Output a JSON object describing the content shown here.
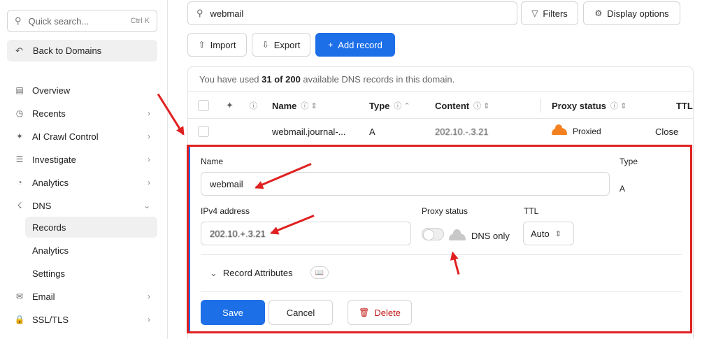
{
  "sidebar": {
    "search": {
      "placeholder": "Quick search...",
      "shortcut": "Ctrl K",
      "icon": "search-icon"
    },
    "back": "Back to Domains",
    "items": [
      {
        "label": "Overview",
        "icon": "overview-icon"
      },
      {
        "label": "Recents",
        "icon": "clock-icon"
      },
      {
        "label": "AI Crawl Control",
        "icon": "ai-icon"
      },
      {
        "label": "Investigate",
        "icon": "investigate-icon"
      },
      {
        "label": "Analytics",
        "icon": "analytics-icon"
      },
      {
        "label": "DNS",
        "icon": "dns-icon"
      },
      {
        "label": "Email",
        "icon": "email-icon"
      },
      {
        "label": "SSL/TLS",
        "icon": "lock-icon"
      }
    ],
    "dns_sub": [
      "Records",
      "Analytics",
      "Settings"
    ]
  },
  "toolbar": {
    "search_value": "webmail",
    "filters": "Filters",
    "display_options": "Display options",
    "import": "Import",
    "export": "Export",
    "add_record": "Add record"
  },
  "table": {
    "usage_prefix": "You have used ",
    "usage_count": "31 of 200",
    "usage_suffix": " available DNS records in this domain.",
    "headers": {
      "name": "Name",
      "type": "Type",
      "content": "Content",
      "proxy": "Proxy status",
      "ttl": "TTL"
    },
    "row": {
      "name": "webmail.journal-...",
      "type": "A",
      "content": "202.10.-.3.21",
      "proxy": "Proxied",
      "action": "Close"
    }
  },
  "edit": {
    "name_label": "Name",
    "name_value": "webmail",
    "type_label": "Type",
    "type_value": "A",
    "ipv4_label": "IPv4 address",
    "ipv4_value": "202.10.+.3.21",
    "proxy_label": "Proxy status",
    "proxy_value": "DNS only",
    "ttl_label": "TTL",
    "ttl_value": "Auto",
    "attributes": "Record Attributes",
    "save": "Save",
    "cancel": "Cancel",
    "delete": "Delete"
  },
  "colors": {
    "accent": "#1d6fe8",
    "annotation": "#e02020",
    "proxied": "#f48120"
  }
}
